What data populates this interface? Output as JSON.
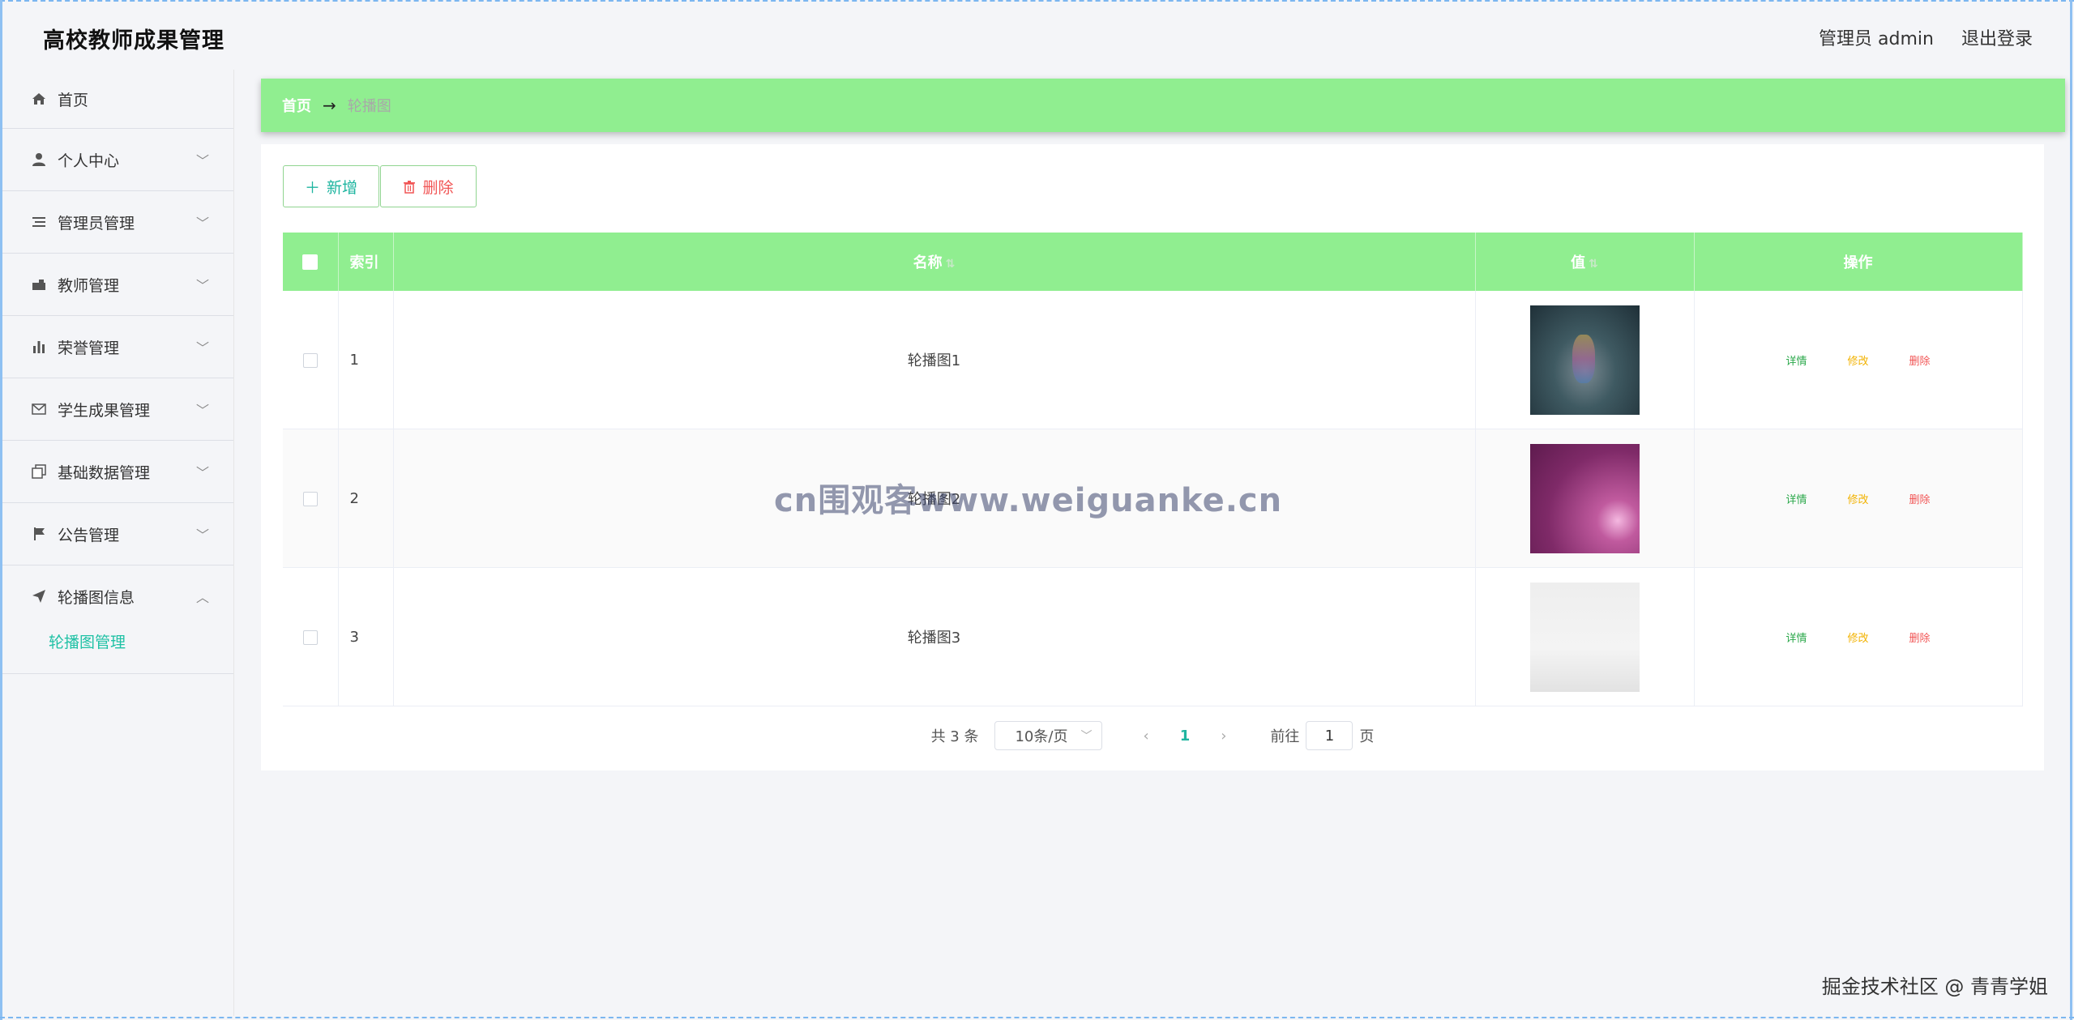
{
  "header": {
    "app_title": "高校教师成果管理",
    "user_label": "管理员 admin",
    "logout_label": "退出登录"
  },
  "sidebar": {
    "items": [
      {
        "label": "首页",
        "icon": "home-icon"
      },
      {
        "label": "个人中心",
        "icon": "user-icon"
      },
      {
        "label": "管理员管理",
        "icon": "list-icon"
      },
      {
        "label": "教师管理",
        "icon": "briefcase-icon"
      },
      {
        "label": "荣誉管理",
        "icon": "bar-chart-icon"
      },
      {
        "label": "学生成果管理",
        "icon": "mail-icon"
      },
      {
        "label": "基础数据管理",
        "icon": "copy-icon"
      },
      {
        "label": "公告管理",
        "icon": "flag-icon"
      },
      {
        "label": "轮播图信息",
        "icon": "send-icon"
      }
    ],
    "submenu": {
      "label": "轮播图管理"
    }
  },
  "breadcrumb": {
    "home": "首页",
    "arrow": "→",
    "current": "轮播图"
  },
  "toolbar": {
    "add_label": "新增",
    "delete_label": "删除"
  },
  "table": {
    "columns": {
      "index": "索引",
      "name": "名称",
      "value": "值",
      "actions": "操作"
    },
    "rows": [
      {
        "index": "1",
        "name": "轮播图1",
        "thumb": "dark teal stage"
      },
      {
        "index": "2",
        "name": "轮播图2",
        "thumb": "purple floral"
      },
      {
        "index": "3",
        "name": "轮播图3",
        "thumb": "light grey texture"
      }
    ],
    "actions": {
      "detail": "详情",
      "edit": "修改",
      "delete": "删除"
    }
  },
  "pagination": {
    "total": "共 3 条",
    "page_size": "10条/页",
    "current_page": "1",
    "goto_prefix": "前往",
    "goto_value": "1",
    "goto_suffix": "页"
  },
  "watermark": "cn围观客www.weiguanke.cn",
  "credit": "掘金技术社区 @ 青青学姐",
  "colors": {
    "accent_green": "#90ee90",
    "teal": "#1fb5a0",
    "danger": "#f15555",
    "warning": "#f2b200"
  }
}
